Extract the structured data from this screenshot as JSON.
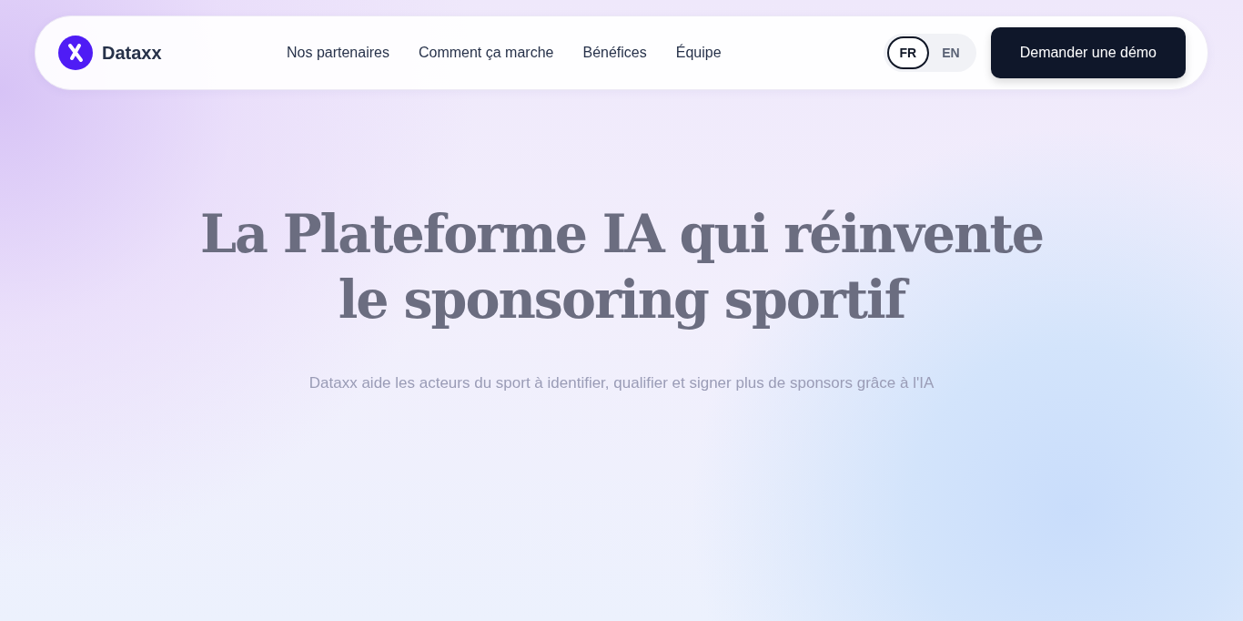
{
  "brand": {
    "name": "Dataxx"
  },
  "nav": [
    {
      "label": "Nos partenaires"
    },
    {
      "label": "Comment ça marche"
    },
    {
      "label": "Bénéfices"
    },
    {
      "label": "Équipe"
    }
  ],
  "languages": [
    {
      "label": "FR",
      "selected": true
    },
    {
      "label": "EN",
      "selected": false
    }
  ],
  "cta": "Demander une démo",
  "hero": {
    "title_lines": [
      "La Plateforme IA qui réinvente",
      "le sponsoring sportif"
    ],
    "subtitle": "Dataxx aide les acteurs du sport à identifier, qualifier et signer plus de sponsors grâce à l'IA"
  }
}
